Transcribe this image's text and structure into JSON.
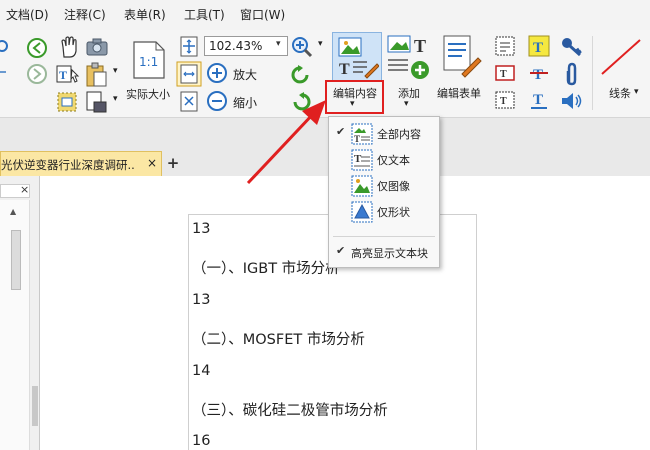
{
  "menubar": {
    "items": [
      "文档(D)",
      "注释(C)",
      "表单(R)",
      "工具(T)",
      "窗口(W)"
    ]
  },
  "ribbon": {
    "actual_size_label": "实际大小",
    "zoom_value": "102.43%",
    "zoom_in_label": "放大",
    "zoom_out_label": "缩小",
    "edit_content_label": "编辑内容",
    "add_label": "添加",
    "edit_form_label": "编辑表单",
    "line_label": "线条"
  },
  "tab": {
    "title": "光伏逆变器行业深度调研..",
    "close": "×",
    "new_tab": "+"
  },
  "dropdown": {
    "items": [
      {
        "label": "全部内容",
        "checked": true,
        "icon": "all-content-icon"
      },
      {
        "label": "仅文本",
        "checked": false,
        "icon": "text-only-icon"
      },
      {
        "label": "仅图像",
        "checked": false,
        "icon": "image-only-icon"
      },
      {
        "label": "仅形状",
        "checked": false,
        "icon": "shape-only-icon"
      }
    ],
    "highlight_item": {
      "label": "高亮显示文本块",
      "checked": true
    }
  },
  "document": {
    "lines": [
      "13",
      "（一）、IGBT 市场分析",
      "13",
      "（二）、MOSFET 市场分析",
      "14",
      "（三）、碳化硅二极管市场分析",
      "16"
    ]
  },
  "colors": {
    "accent_red": "#e02020",
    "tab_yellow": "#fbe7a4",
    "icon_blue": "#2a6fc0",
    "icon_green": "#3a9a2a"
  }
}
